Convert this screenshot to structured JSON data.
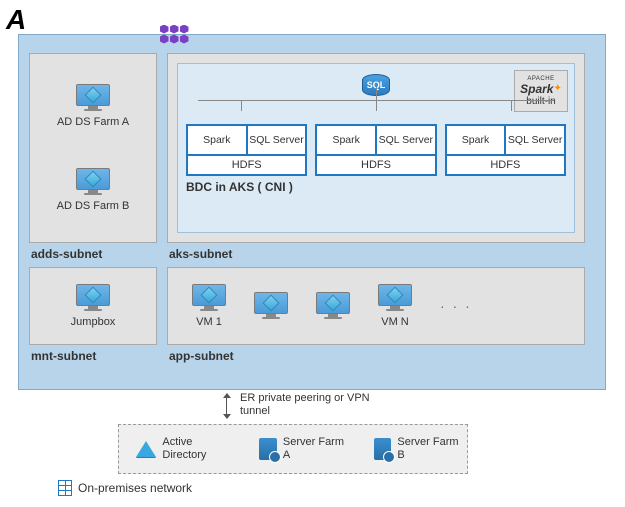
{
  "brand": {
    "logo_text": "A"
  },
  "vnet": {
    "adds_subnet": {
      "label": "adds-subnet",
      "vms": [
        {
          "label": "AD DS Farm A"
        },
        {
          "label": "AD DS Farm B"
        }
      ]
    },
    "mnt_subnet": {
      "label": "mnt-subnet",
      "vm": {
        "label": "Jumpbox"
      }
    },
    "aks_subnet": {
      "label": "aks-subnet",
      "bdc": {
        "caption": "BDC in AKS ( CNI )",
        "sql_badge": "SQL",
        "spark": {
          "logo": "Spark",
          "subtext": "built-in",
          "prefix": "APACHE"
        },
        "nodes": [
          {
            "left": "Spark",
            "right": "SQL Server",
            "bottom": "HDFS"
          },
          {
            "left": "Spark",
            "right": "SQL Server",
            "bottom": "HDFS"
          },
          {
            "left": "Spark",
            "right": "SQL Server",
            "bottom": "HDFS"
          }
        ]
      }
    },
    "app_subnet": {
      "label": "app-subnet",
      "first_vm": "VM 1",
      "last_vm": "VM N",
      "ellipsis": "· · ·"
    }
  },
  "connection": {
    "label": "ER private peering or VPN tunnel"
  },
  "onprem": {
    "label": "On-premises network",
    "items": [
      {
        "label": "Active Directory"
      },
      {
        "label": "Server Farm A"
      },
      {
        "label": "Server Farm B"
      }
    ]
  }
}
